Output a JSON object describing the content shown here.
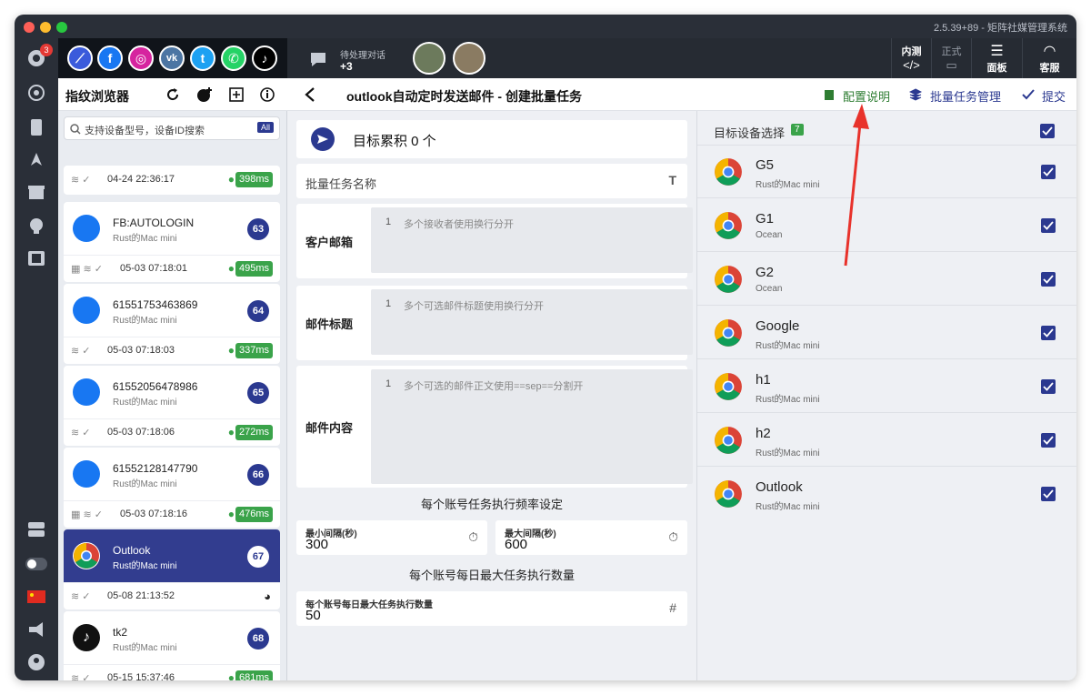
{
  "app": {
    "version": "2.5.39+89 - 矩阵社媒管理系统"
  },
  "rail": {
    "badge": "3"
  },
  "topbar": {
    "pending_label": "待处理对话",
    "pending_count": "+3",
    "btn_internal_label": "内测",
    "btn_official_label": "正式",
    "btn_panel_label": "面板",
    "btn_support_label": "客服"
  },
  "sidebar": {
    "title": "指纹浏览器",
    "search_placeholder": "支持设备型号，设备ID搜索",
    "search_badge": "All",
    "cards": [
      {
        "name": "",
        "sub": "",
        "num": "",
        "time": "04-24 22:36:17",
        "ping": "398ms"
      },
      {
        "name": "FB:AUTOLOGIN",
        "sub": "Rust的Mac mini",
        "num": "63",
        "time": "05-03 07:18:01",
        "ping": "495ms"
      },
      {
        "name": "61551753463869",
        "sub": "Rust的Mac mini",
        "num": "64",
        "time": "05-03 07:18:03",
        "ping": "337ms"
      },
      {
        "name": "61552056478986",
        "sub": "Rust的Mac mini",
        "num": "65",
        "time": "05-03 07:18:06",
        "ping": "272ms"
      },
      {
        "name": "61552128147790",
        "sub": "Rust的Mac mini",
        "num": "66",
        "time": "05-03 07:18:16",
        "ping": "476ms"
      },
      {
        "name": "Outlook",
        "sub": "Rust的Mac mini",
        "num": "67",
        "time": "05-08 21:13:52",
        "ping": ""
      },
      {
        "name": "tk2",
        "sub": "Rust的Mac mini",
        "num": "68",
        "time": "05-15 15:37:46",
        "ping": "681ms"
      }
    ]
  },
  "header": {
    "title": "outlook自动定时发送邮件 - 创建批量任务",
    "config_link": "配置说明",
    "manage_link": "批量任务管理",
    "submit_link": "提交"
  },
  "form": {
    "target_count": "目标累积 0 个",
    "task_name_label": "批量任务名称",
    "email_label": "客户邮箱",
    "email_ln": "1",
    "email_placeholder": "多个接收者使用换行分开",
    "subject_label": "邮件标题",
    "subject_ln": "1",
    "subject_placeholder": "多个可选邮件标题使用换行分开",
    "body_label": "邮件内容",
    "body_ln": "1",
    "body_placeholder": "多个可选的邮件正文使用==sep==分割开",
    "freq_section": "每个账号任务执行频率设定",
    "min_label": "最小间隔(秒)",
    "min_value": "300",
    "max_label": "最大间隔(秒)",
    "max_value": "600",
    "daily_section": "每个账号每日最大任务执行数量",
    "daily_label": "每个账号每日最大任务执行数量",
    "daily_value": "50"
  },
  "devices": {
    "title": "目标设备选择",
    "count": "7",
    "items": [
      {
        "name": "G5",
        "sub": "Rust的Mac mini"
      },
      {
        "name": "G1",
        "sub": "Ocean"
      },
      {
        "name": "G2",
        "sub": "Ocean"
      },
      {
        "name": "Google",
        "sub": "Rust的Mac mini"
      },
      {
        "name": "h1",
        "sub": "Rust的Mac mini"
      },
      {
        "name": "h2",
        "sub": "Rust的Mac mini"
      },
      {
        "name": "Outlook",
        "sub": "Rust的Mac mini"
      }
    ]
  },
  "colors": {
    "accent": "#2b3990",
    "green": "#3aa34a",
    "annotation": "#e8322b"
  }
}
